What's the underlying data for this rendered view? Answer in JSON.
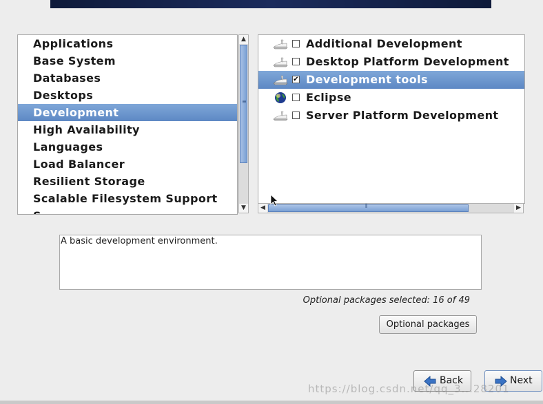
{
  "categories": {
    "items": [
      "Applications",
      "Base System",
      "Databases",
      "Desktops",
      "Development",
      "High Availability",
      "Languages",
      "Load Balancer",
      "Resilient Storage",
      "Scalable Filesystem Support",
      "S"
    ],
    "selected_index": 4
  },
  "groups": {
    "items": [
      {
        "label": "Additional Development",
        "checked": false,
        "icon": "package-icon"
      },
      {
        "label": "Desktop Platform Development",
        "checked": false,
        "icon": "package-icon"
      },
      {
        "label": "Development tools",
        "checked": true,
        "icon": "package-icon"
      },
      {
        "label": "Eclipse",
        "checked": false,
        "icon": "globe-icon"
      },
      {
        "label": "Server Platform Development",
        "checked": false,
        "icon": "package-icon"
      }
    ],
    "selected_index": 2
  },
  "description": "A basic development environment.",
  "optional_count_text": "Optional packages selected: 16 of 49",
  "buttons": {
    "optional_packages": "Optional packages",
    "back": "Back",
    "next": "Next"
  },
  "watermark": "https://blog.csdn.net/qq_3...28201",
  "colors": {
    "selection": "#6a94cc",
    "scroll_thumb": "#8cafe0"
  }
}
